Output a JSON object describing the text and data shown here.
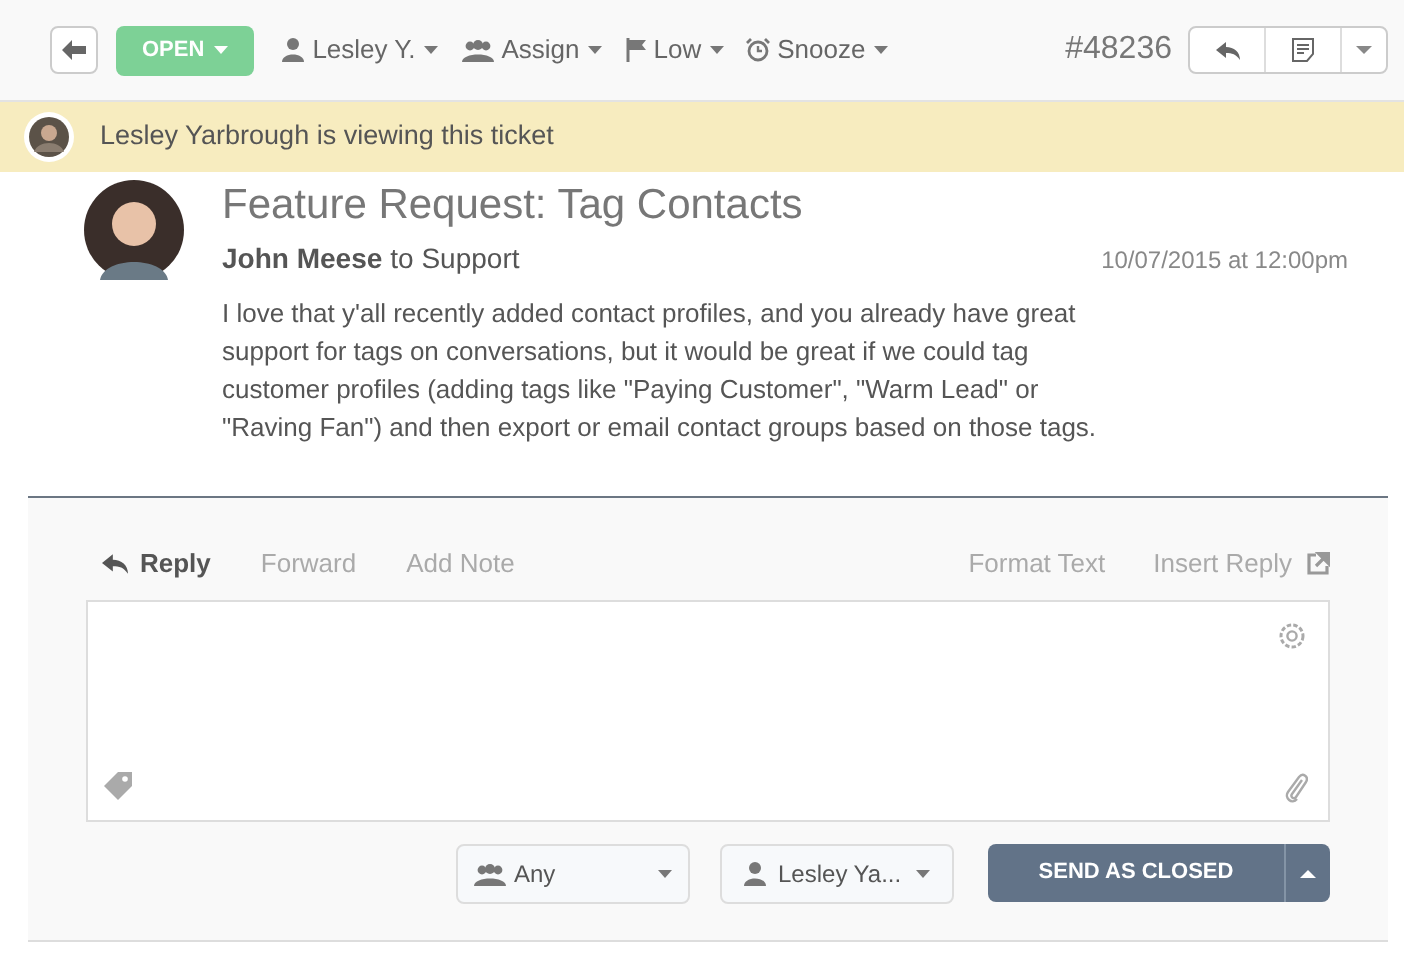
{
  "toolbar": {
    "status": "OPEN",
    "assignee": "Lesley Y.",
    "assign": "Assign",
    "priority": "Low",
    "snooze": "Snooze",
    "ticket_number": "#48236"
  },
  "viewer_banner": "Lesley Yarbrough is viewing this ticket",
  "message": {
    "title": "Feature Request: Tag Contacts",
    "author": "John Meese",
    "recipient": "to Support",
    "date": "10/07/2015 at 12:00pm",
    "body": "I love that y'all recently added contact profiles, and you already have great support for tags on conversations, but it would be great if we could tag customer profiles (adding tags like \"Paying Customer\", \"Warm Lead\" or \"Raving Fan\") and then export or email contact groups based on those tags."
  },
  "reply": {
    "tabs": [
      {
        "label": "Reply",
        "selected": true
      },
      {
        "label": "Forward",
        "selected": false
      },
      {
        "label": "Add Note",
        "selected": false
      }
    ],
    "format_text": "Format Text",
    "insert_reply": "Insert Reply",
    "team_select": "Any",
    "user_select": "Lesley Ya...",
    "send_button": "SEND AS CLOSED"
  }
}
